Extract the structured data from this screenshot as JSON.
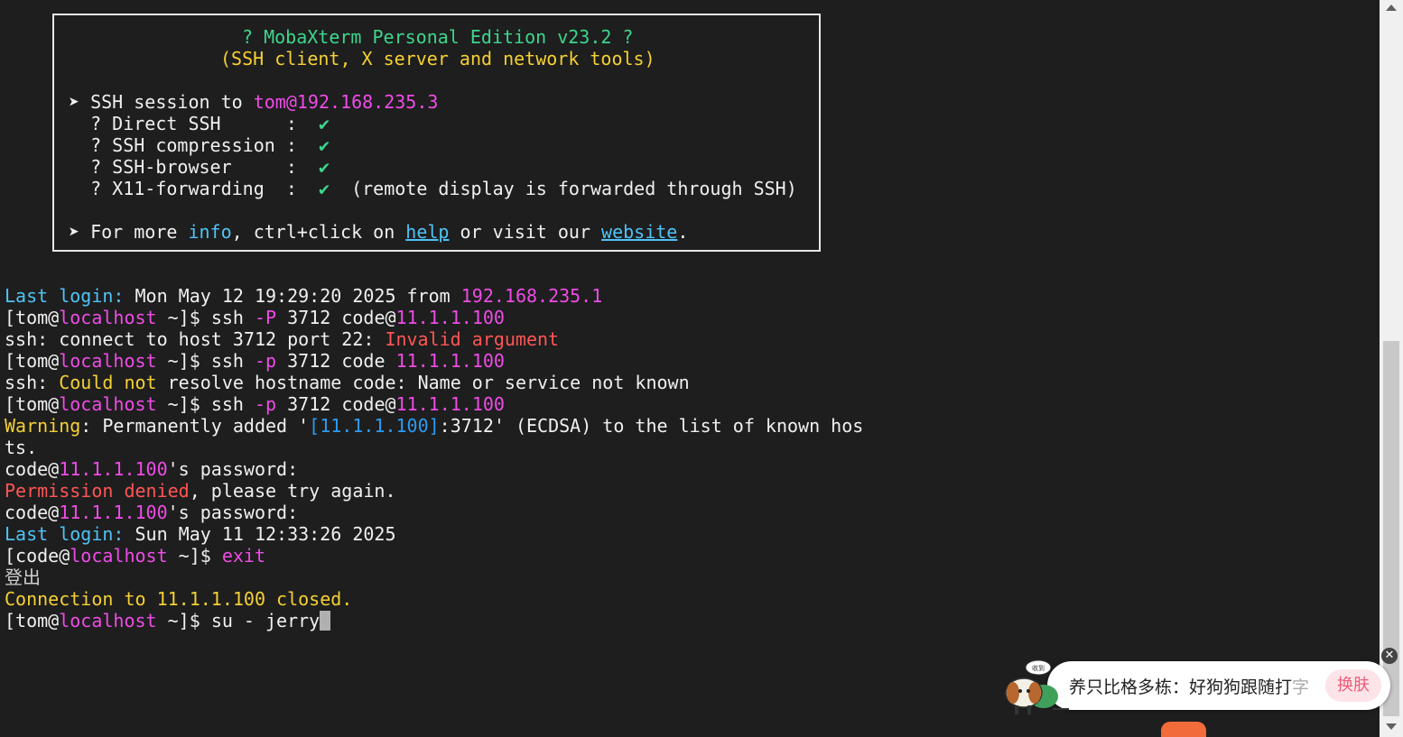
{
  "banner": {
    "title": "? MobaXterm Personal Edition v23.2 ?",
    "subtitle": "(SSH client, X server and network tools)",
    "bullet": "➤",
    "session_label": " SSH session to ",
    "session_target": "tom@192.168.235.3",
    "features": [
      {
        "prefix": "  ? ",
        "name": "Direct SSH      ",
        "sep": ":  ",
        "check": "✔",
        "note": ""
      },
      {
        "prefix": "  ? ",
        "name": "SSH compression ",
        "sep": ":  ",
        "check": "✔",
        "note": ""
      },
      {
        "prefix": "  ? ",
        "name": "SSH-browser     ",
        "sep": ":  ",
        "check": "✔",
        "note": ""
      },
      {
        "prefix": "  ? ",
        "name": "X11-forwarding  ",
        "sep": ":  ",
        "check": "✔",
        "note": "  (remote display is forwarded through SSH)"
      }
    ],
    "info_prefix": " For more ",
    "info_word": "info",
    "info_mid": ", ctrl+click on ",
    "help_link": "help",
    "info_mid2": " or visit our ",
    "website_link": "website",
    "info_end": "."
  },
  "terminal": {
    "l1": {
      "label": "Last login:",
      "text": " Mon May 12 19:29:20 2025 from ",
      "ip": "192.168.235.1"
    },
    "prompt_open": "[tom@",
    "prompt_host": "localhost",
    "prompt_close": " ~]$ ",
    "l2": {
      "cmd": "ssh ",
      "flag": "-P",
      "args": " 3712 code@",
      "ip": "11.1.1.100"
    },
    "l3": {
      "text": "ssh: connect to host 3712 port 22: ",
      "err": "Invalid argument"
    },
    "l4": {
      "cmd": "ssh ",
      "flag": "-p",
      "args": " 3712 code ",
      "ip": "11.1.1.100"
    },
    "l5": {
      "pre": "ssh: ",
      "warn": "Could not",
      "text": " resolve hostname code: Name or service not known"
    },
    "l6": {
      "cmd": "ssh ",
      "flag": "-p",
      "args": " 3712 code@",
      "ip": "11.1.1.100"
    },
    "l7": {
      "warn": "Warning",
      "text": ": Permanently added '",
      "host": "[11.1.1.100]",
      "rest": ":3712' (ECDSA) to the list of known hos"
    },
    "l8": "ts.",
    "l9": {
      "pre": "code@",
      "ip": "11.1.1.100",
      "text": "'s password:"
    },
    "l10": {
      "err": "Permission denied",
      "text": ", please try again."
    },
    "l11": {
      "pre": "code@",
      "ip": "11.1.1.100",
      "text": "'s password:"
    },
    "l12": {
      "label": "Last login:",
      "text": " Sun May 11 12:33:26 2025"
    },
    "l13": {
      "open": "[code@",
      "host": "localhost",
      "close": " ~]$ ",
      "cmd": "exit"
    },
    "l14": "登出",
    "l15": "Connection to 11.1.1.100 closed.",
    "l16": {
      "cmd": "su - jerry"
    }
  },
  "ime": {
    "text": "养只比格多栋：好狗狗跟随打",
    "text_fade": "字",
    "skin_button": "换肤",
    "close": "✕",
    "mascot_badge": "收到"
  }
}
